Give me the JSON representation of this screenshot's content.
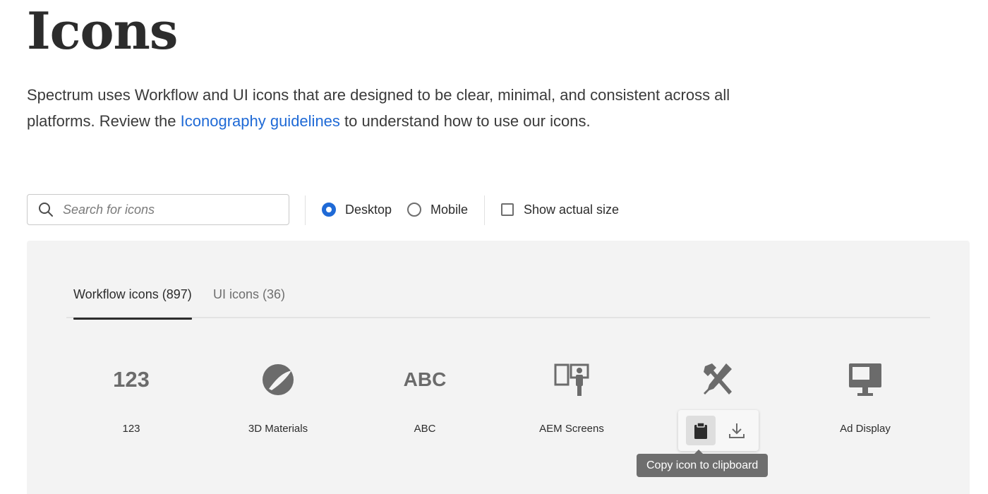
{
  "header": {
    "title": "Icons",
    "intro_before_link": "Spectrum uses Workflow and UI icons that are designed to be clear, minimal, and consistent across all platforms. Review the ",
    "intro_link": "Iconography guidelines",
    "intro_after_link": " to understand how to use our icons."
  },
  "toolbar": {
    "search_placeholder": "Search for icons",
    "platform_options": [
      {
        "label": "Desktop",
        "selected": true
      },
      {
        "label": "Mobile",
        "selected": false
      }
    ],
    "show_actual_size_label": "Show actual size",
    "show_actual_size_checked": false
  },
  "tabs": [
    {
      "label": "Workflow icons (897)",
      "active": true
    },
    {
      "label": "UI icons (36)",
      "active": false
    }
  ],
  "icons": [
    {
      "name": "123",
      "glyph_text": "123"
    },
    {
      "name": "3D Materials"
    },
    {
      "name": "ABC",
      "glyph_text": "ABC"
    },
    {
      "name": "AEM Screens"
    },
    {
      "name": ""
    },
    {
      "name": "Ad Display"
    }
  ],
  "hover_actions": {
    "tooltip": "Copy icon to clipboard"
  },
  "colors": {
    "accent": "#1f6ad6",
    "icon_gray": "#6b6b6b",
    "panel_bg": "#f3f3f3"
  }
}
